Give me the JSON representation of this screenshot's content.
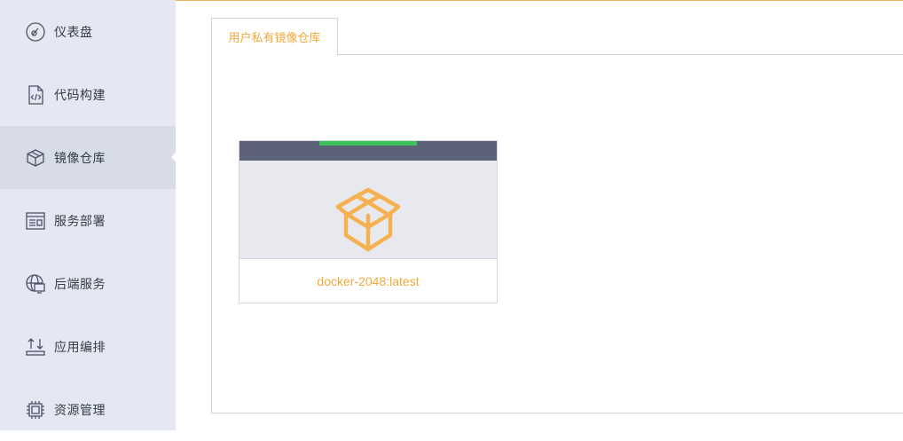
{
  "sidebar": {
    "items": [
      {
        "label": "仪表盘",
        "icon": "dashboard-icon"
      },
      {
        "label": "代码构建",
        "icon": "code-file-icon"
      },
      {
        "label": "镜像仓库",
        "icon": "box-icon",
        "active": true
      },
      {
        "label": "服务部署",
        "icon": "deploy-window-icon"
      },
      {
        "label": "后端服务",
        "icon": "globe-monitor-icon"
      },
      {
        "label": "应用编排",
        "icon": "arrange-icon"
      },
      {
        "label": "资源管理",
        "icon": "chip-icon"
      }
    ]
  },
  "main": {
    "tabs": [
      {
        "label": "用户私有镜像仓库",
        "active": true
      }
    ],
    "images": [
      {
        "name": "docker-2048:latest",
        "icon": "open-box-icon"
      }
    ]
  },
  "colors": {
    "accent": "#f0a93a",
    "sidebar_bg": "#e5e8f3",
    "card_header": "#5c6378",
    "status_green": "#3cc25a"
  }
}
